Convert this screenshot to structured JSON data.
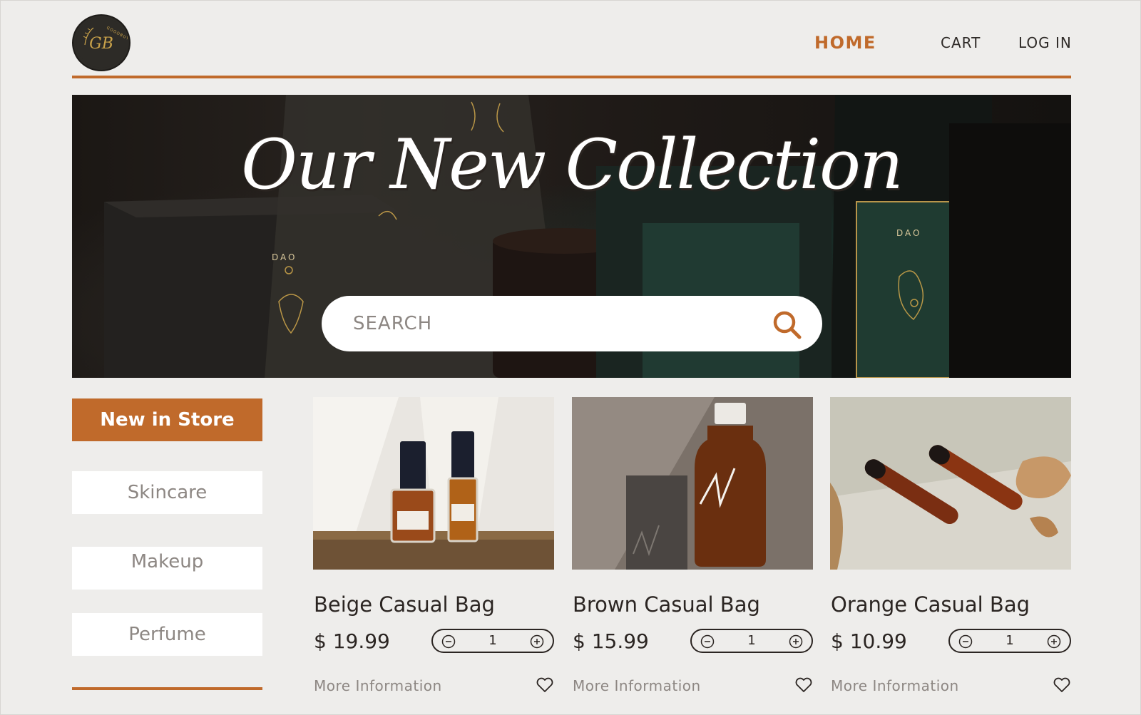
{
  "brand": {
    "logo_initials": "GB",
    "logo_ring_text": "GOODBUY"
  },
  "nav": {
    "home": "HOME",
    "cart": "CART",
    "login": "LOG IN"
  },
  "hero": {
    "title": "Our New Collection",
    "search_placeholder": "SEARCH"
  },
  "sidebar": {
    "new_in_store": "New in Store",
    "categories": [
      "Skincare",
      "Makeup",
      "Perfume"
    ]
  },
  "products": [
    {
      "name": "Beige Casual Bag",
      "price": "$ 19.99",
      "qty": "1",
      "more": "More Information"
    },
    {
      "name": "Brown Casual Bag",
      "price": "$ 15.99",
      "qty": "1",
      "more": "More Information"
    },
    {
      "name": "Orange Casual Bag",
      "price": "$ 10.99",
      "qty": "1",
      "more": "More Information"
    }
  ],
  "colors": {
    "accent": "#c06a2b",
    "background": "#eeedeb",
    "text": "#2b2522",
    "muted": "#8d8783"
  }
}
